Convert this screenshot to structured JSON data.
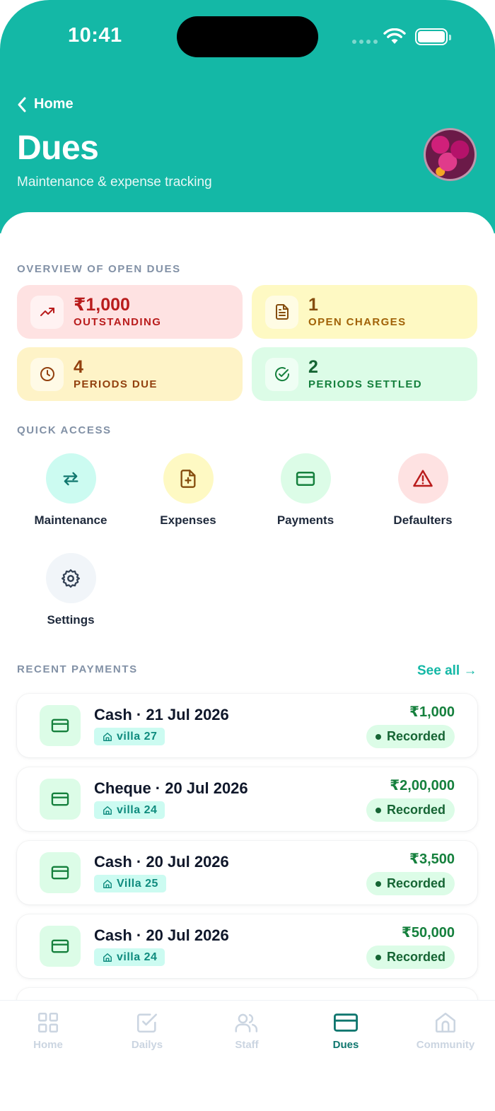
{
  "status_bar": {
    "time": "10:41"
  },
  "header": {
    "back_label": "Home",
    "title": "Dues",
    "subtitle": "Maintenance & expense tracking"
  },
  "overview": {
    "section_label": "OVERVIEW OF OPEN DUES",
    "stats": [
      {
        "value": "₹1,000",
        "label": "OUTSTANDING",
        "icon": "trending-up-icon",
        "bg": "#fee2e2",
        "color": "#b91c1c"
      },
      {
        "value": "1",
        "label": "OPEN CHARGES",
        "icon": "document-icon",
        "bg": "#fef9c3",
        "color": "#854d0e"
      },
      {
        "value": "4",
        "label": "PERIODS DUE",
        "icon": "clock-icon",
        "bg": "#fef3c7",
        "color": "#92400e"
      },
      {
        "value": "2",
        "label": "PERIODS SETTLED",
        "icon": "check-circle-icon",
        "bg": "#dcfce7",
        "color": "#15803d"
      }
    ]
  },
  "quick_access": {
    "section_label": "QUICK ACCESS",
    "items": [
      {
        "label": "Maintenance",
        "icon": "swap-arrows-icon",
        "bg": "#ccfbf1"
      },
      {
        "label": "Expenses",
        "icon": "file-plus-icon",
        "bg": "#fef9c3"
      },
      {
        "label": "Payments",
        "icon": "credit-card-icon",
        "bg": "#dcfce7"
      },
      {
        "label": "Defaulters",
        "icon": "warning-icon",
        "bg": "#fee2e2"
      },
      {
        "label": "Settings",
        "icon": "gear-icon",
        "bg": "#f1f5f9"
      }
    ]
  },
  "recent_payments": {
    "section_label": "RECENT PAYMENTS",
    "see_all": "See all →",
    "items": [
      {
        "title": "Cash · 21 Jul 2026",
        "villa": "villa 27",
        "amount": "₹1,000",
        "status": "Recorded"
      },
      {
        "title": "Cheque · 20 Jul 2026",
        "villa": "villa 24",
        "amount": "₹2,00,000",
        "status": "Recorded"
      },
      {
        "title": "Cash · 20 Jul 2026",
        "villa": "Villa 25",
        "amount": "₹3,500",
        "status": "Recorded"
      },
      {
        "title": "Cash · 20 Jul 2026",
        "villa": "villa 24",
        "amount": "₹50,000",
        "status": "Recorded"
      }
    ]
  },
  "tab_bar": {
    "tabs": [
      {
        "label": "Home",
        "icon": "grid-icon"
      },
      {
        "label": "Dailys",
        "icon": "checkbox-icon"
      },
      {
        "label": "Staff",
        "icon": "users-icon"
      },
      {
        "label": "Dues",
        "icon": "credit-card-icon",
        "active": true
      },
      {
        "label": "Community",
        "icon": "house-icon"
      }
    ]
  }
}
